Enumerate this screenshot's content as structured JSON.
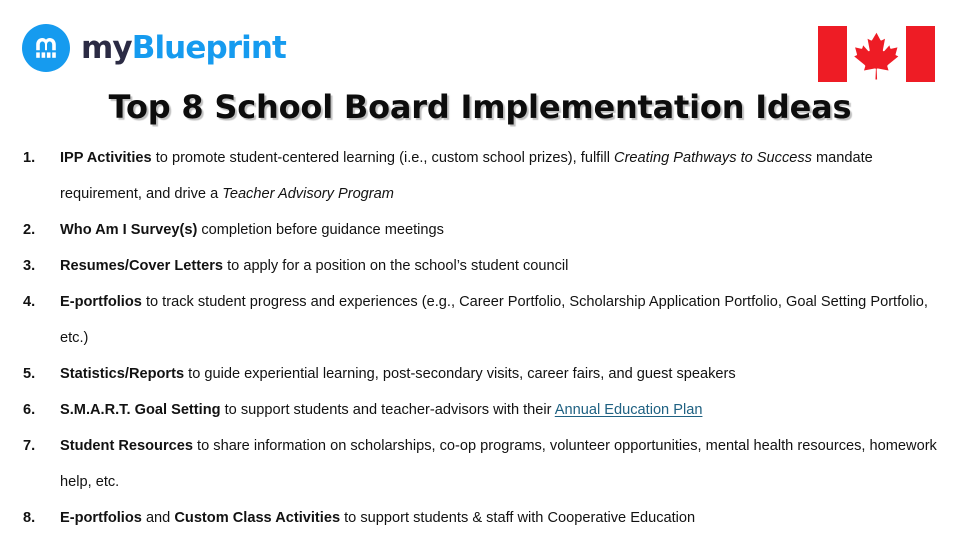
{
  "brand": {
    "logo_icon": "myblueprint-logo-icon",
    "wordmark_prefix": "my",
    "wordmark_suffix": "Blueprint",
    "navy": "#2B2B44",
    "blue": "#169BEF"
  },
  "flag": {
    "icon": "canadian-flag-icon",
    "name": "Canada",
    "red": "#EE1C25",
    "white": "#FFFFFF"
  },
  "title": "Top 8 School Board Implementation Ideas",
  "link_color": "#1F6182",
  "ideas": [
    {
      "number": "1.",
      "plain": "1. IPP Activities to promote student-centered learning (i.e., custom school prizes), fulfill Creating Pathways to Success mandate requirement, and drive a Teacher Advisory Program",
      "runs": [
        {
          "text": "IPP Activities",
          "style": "bold"
        },
        {
          "text": " to promote student-centered learning (i.e., custom school prizes), fulfill ",
          "style": "normal"
        },
        {
          "text": "Creating Pathways to Success",
          "style": "italic"
        },
        {
          "text": " mandate requirement, and drive a ",
          "style": "normal"
        },
        {
          "text": "Teacher Advisory Program",
          "style": "italic"
        }
      ]
    },
    {
      "number": "2.",
      "plain": "2. Who Am I Survey(s) completion before guidance meetings",
      "runs": [
        {
          "text": "Who Am I Survey(s)",
          "style": "bold"
        },
        {
          "text": " completion before guidance meetings",
          "style": "normal"
        }
      ]
    },
    {
      "number": "3.",
      "plain": "3. Resumes/Cover Letters to apply for a position on the school’s student council",
      "runs": [
        {
          "text": "Resumes/Cover Letters",
          "style": "bold"
        },
        {
          "text": " to apply for a position on the school’s student council",
          "style": "normal"
        }
      ]
    },
    {
      "number": "4.",
      "plain": "4. E-portfolios to track student progress and experiences (e.g., Career Portfolio, Scholarship Application Portfolio, Goal Setting Portfolio, etc.)",
      "runs": [
        {
          "text": "E-portfolios",
          "style": "bold"
        },
        {
          "text": " to track student progress and experiences (e.g., Career Portfolio, Scholarship Application Portfolio, Goal Setting Portfolio, etc.)",
          "style": "normal"
        }
      ]
    },
    {
      "number": "5.",
      "plain": "5. Statistics/Reports to guide experiential learning, post-secondary visits, career fairs, and guest speakers",
      "runs": [
        {
          "text": "Statistics/Reports",
          "style": "bold"
        },
        {
          "text": " to guide experiential learning, post-secondary visits, career fairs, and guest speakers",
          "style": "normal"
        }
      ]
    },
    {
      "number": "6.",
      "plain": "6. S.M.A.R.T. Goal Setting to support students and teacher-advisors with their Annual Education Plan",
      "runs": [
        {
          "text": "S.M.A.R.T. Goal Setting",
          "style": "bold"
        },
        {
          "text": " to support students and teacher-advisors with their ",
          "style": "normal"
        },
        {
          "text": "Annual Education Plan",
          "style": "link"
        }
      ]
    },
    {
      "number": "7.",
      "plain": "7. Student Resources to share information on scholarships, co-op programs, volunteer opportunities, mental health resources, homework help, etc.",
      "runs": [
        {
          "text": "Student Resources",
          "style": "bold"
        },
        {
          "text": " to share information on scholarships, co-op programs, volunteer opportunities, mental health resources, homework help, etc.",
          "style": "normal"
        }
      ]
    },
    {
      "number": "8.",
      "plain": "8. E-portfolios and Custom Class Activities to support students & staff with Cooperative Education",
      "runs": [
        {
          "text": "E-portfolios",
          "style": "bold"
        },
        {
          "text": " and ",
          "style": "normal"
        },
        {
          "text": "Custom Class Activities",
          "style": "bold"
        },
        {
          "text": " to support students & staff with Cooperative Education",
          "style": "normal"
        }
      ]
    }
  ]
}
